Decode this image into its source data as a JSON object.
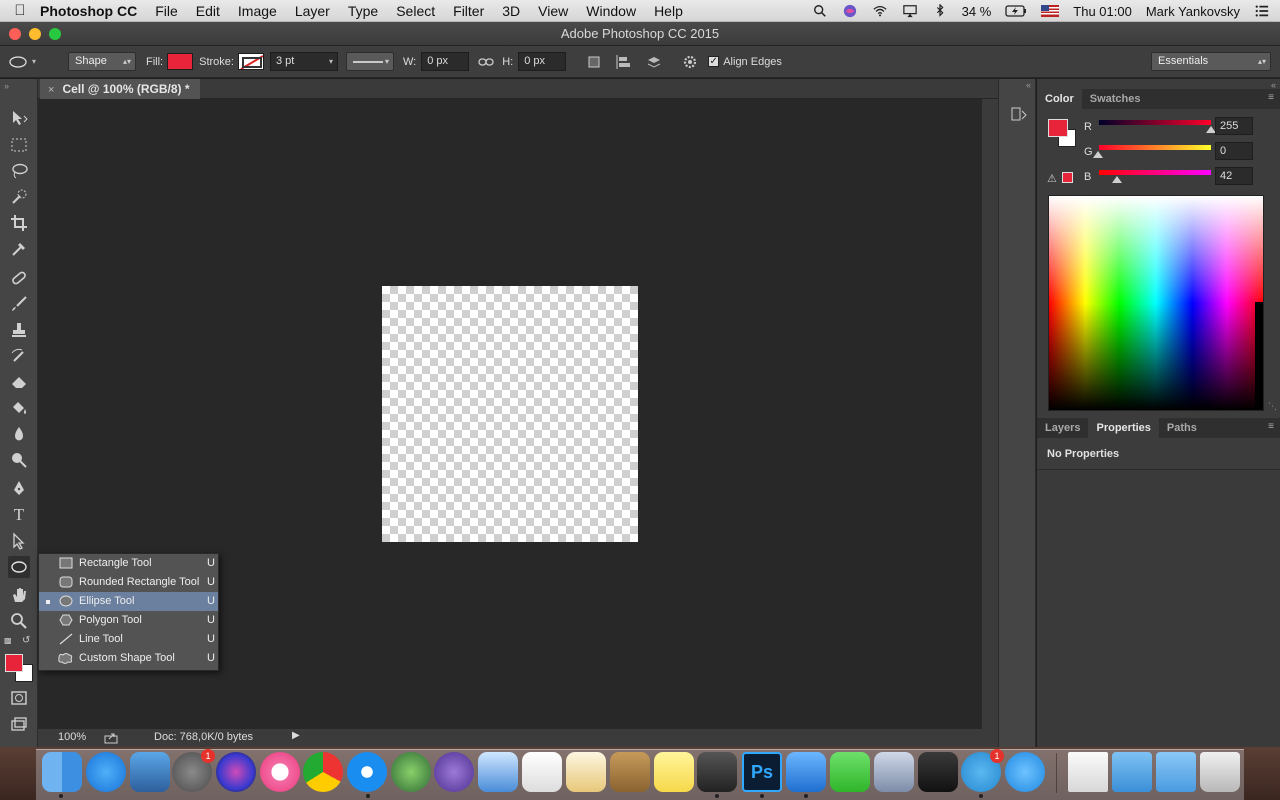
{
  "menubar": {
    "app_name": "Photoshop CC",
    "items": [
      "File",
      "Edit",
      "Image",
      "Layer",
      "Type",
      "Select",
      "Filter",
      "3D",
      "View",
      "Window",
      "Help"
    ],
    "battery": "34 %",
    "clock": "Thu 01:00",
    "user": "Mark Yankovsky"
  },
  "window": {
    "title": "Adobe Photoshop CC 2015"
  },
  "options": {
    "mode": "Shape",
    "fill_label": "Fill:",
    "stroke_label": "Stroke:",
    "stroke_width": "3 pt",
    "w_label": "W:",
    "w_value": "0 px",
    "h_label": "H:",
    "h_value": "0 px",
    "align_edges": "Align Edges",
    "workspace": "Essentials",
    "fill_color": "#e8243a"
  },
  "document": {
    "tab_title": "Cell @ 100% (RGB/8) *",
    "zoom": "100%",
    "doc_info": "Doc: 768,0K/0 bytes"
  },
  "shape_flyout": {
    "items": [
      {
        "label": "Rectangle Tool",
        "key": "U"
      },
      {
        "label": "Rounded Rectangle Tool",
        "key": "U"
      },
      {
        "label": "Ellipse Tool",
        "key": "U"
      },
      {
        "label": "Polygon Tool",
        "key": "U"
      },
      {
        "label": "Line Tool",
        "key": "U"
      },
      {
        "label": "Custom Shape Tool",
        "key": "U"
      }
    ],
    "selected": "Ellipse Tool"
  },
  "color_panel": {
    "tabs": [
      "Color",
      "Swatches"
    ],
    "r_label": "R",
    "g_label": "G",
    "b_label": "B",
    "r": "255",
    "g": "0",
    "b": "42",
    "foreground": "#e8243a"
  },
  "layers_panel": {
    "tabs": [
      "Layers",
      "Properties",
      "Paths"
    ],
    "active_tab": "Properties",
    "message": "No Properties"
  },
  "colors": {
    "accent_selection": "#6b7f9e",
    "badge": "#e5322b"
  }
}
